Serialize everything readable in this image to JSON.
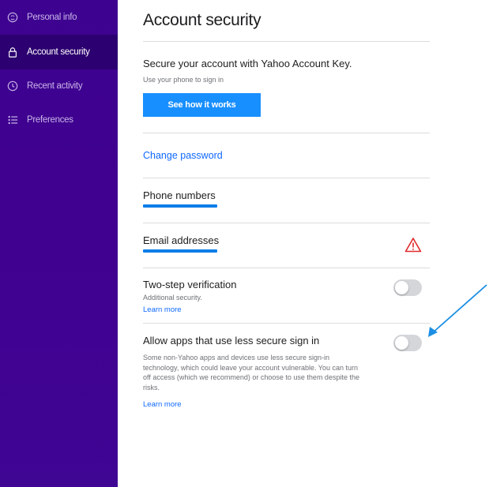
{
  "sidebar": {
    "items": [
      {
        "label": "Personal info",
        "icon": "face-icon",
        "active": false
      },
      {
        "label": "Account security",
        "icon": "lock-icon",
        "active": true
      },
      {
        "label": "Recent activity",
        "icon": "clock-icon",
        "active": false
      },
      {
        "label": "Preferences",
        "icon": "list-icon",
        "active": false
      }
    ]
  },
  "main": {
    "title": "Account security",
    "account_key": {
      "heading": "Secure your account with Yahoo Account Key.",
      "subtext": "Use your phone to sign in",
      "button_label": "See how it works"
    },
    "change_password_label": "Change password",
    "phone_numbers": {
      "heading": "Phone numbers"
    },
    "email_addresses": {
      "heading": "Email addresses",
      "warning_icon": "warning-triangle-icon"
    },
    "two_step": {
      "heading": "Two-step verification",
      "subtext": "Additional security.",
      "learn_more": "Learn more",
      "enabled": false
    },
    "less_secure": {
      "heading": "Allow apps that use less secure sign in",
      "description": "Some non-Yahoo apps and devices use less secure sign-in technology, which could leave your account vulnerable. You can turn off access (which we recommend) or choose to use them despite the risks.",
      "learn_more": "Learn more",
      "enabled": false
    }
  },
  "colors": {
    "sidebar_bg": "#400090",
    "sidebar_active_bg": "#2c0070",
    "accent_blue": "#188fff",
    "link_blue": "#0f69ff",
    "warning_red": "#e0292b",
    "annotation_arrow": "#1a8fe3"
  }
}
